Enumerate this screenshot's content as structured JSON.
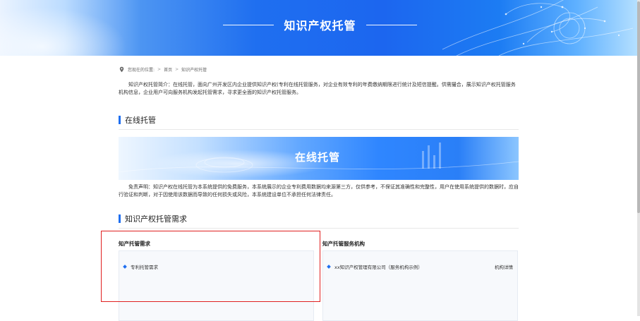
{
  "banner": {
    "title": "知识产权托管"
  },
  "breadcrumb": {
    "prefix": "您现在的位置:",
    "sep": ">",
    "home": "首页",
    "current": "知识产权托管"
  },
  "intro": "知识产权托管简介：在线托管，面向广州开发区内企业提供知识产权(专利在线托管服务，对企业有效专利的年费缴纳期限进行统计及短信提醒。供需撮合，展示知识产权托管服务机构信息，企业用户可向服务机构发起托管需求，寻求更全面的知识产权托管服务。",
  "section_online": {
    "title": "在线托管",
    "banner_title": "在线托管"
  },
  "disclaimer": "免责声明：知识产权在线托管为本系统提供的免费服务，本系统展示的企业专利费用数据均来源第三方，仅供参考，不保证其准确性和完整性，用户在使用系统提供的数据时，应自行验证和判断，对于因使用该数据而导致的任何损失或风险，本系统建设单位不承担任何法律责任。",
  "section_demand": {
    "title": "知识产权托管需求"
  },
  "panels": {
    "demand": {
      "title": "知产托管需求",
      "items": [
        {
          "label": "专利托管需求"
        }
      ]
    },
    "agency": {
      "title": "知产托管服务机构",
      "items": [
        {
          "label": "xx知识产权管理有限公司（服务机构示例）",
          "link": "机构详情"
        }
      ]
    }
  },
  "colors": {
    "accent": "#1f6ff0",
    "highlight": "#e02020"
  }
}
